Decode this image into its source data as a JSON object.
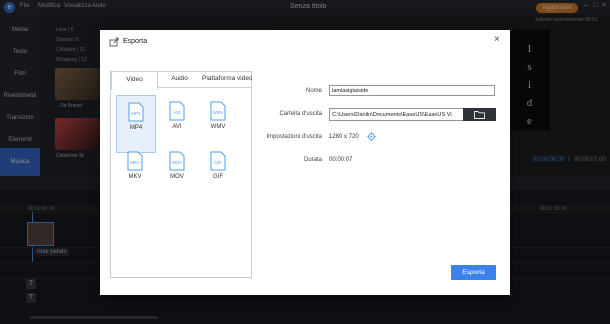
{
  "app": {
    "menu": [
      "File",
      "Modifica",
      "Visualizza",
      "Aiuto"
    ],
    "title": "Senza titolo",
    "upgrade_label": "Aggiornare",
    "saved_text": "Salvato recentemente 08:51",
    "timecode_current": "00:00:00.00",
    "timecode_sep": "/",
    "timecode_total": "00:00:07.00"
  },
  "sidebar": {
    "items": [
      {
        "label": "Media"
      },
      {
        "label": "Testo"
      },
      {
        "label": "Filtri"
      },
      {
        "label": "Rivestimenti"
      },
      {
        "label": "Transizion"
      },
      {
        "label": "Elementi"
      },
      {
        "label": "Musica"
      }
    ]
  },
  "media": {
    "list": [
      "Lista | 6",
      "Sfondo | 8",
      "Cellulare | 31",
      "Shopping | 13"
    ],
    "thumbs": [
      {
        "label": "Da Bravel"
      },
      {
        "label": "Celebrate Sr"
      }
    ]
  },
  "preview": {
    "letters": [
      "I",
      "s",
      "i",
      "d",
      "e"
    ]
  },
  "timeline": {
    "ruler_start": "00:00:00.00",
    "ruler_end": "00:01:38.00",
    "clip_name": "rose petals",
    "text_marker": "T"
  },
  "dialog": {
    "title": "Esporta",
    "close": "×",
    "tabs": [
      "Video",
      "Audio",
      "Piattaforma video"
    ],
    "formats": [
      {
        "ext": "MP4",
        "label": "MP4",
        "selected": true
      },
      {
        "ext": "AVI",
        "label": "AVI",
        "selected": false
      },
      {
        "ext": "WMV",
        "label": "WMV",
        "selected": false
      },
      {
        "ext": "MKV",
        "label": "MKV",
        "selected": false
      },
      {
        "ext": "MOV",
        "label": "MOV",
        "selected": false
      },
      {
        "ext": "GIF",
        "label": "GIF",
        "selected": false
      }
    ],
    "name_label": "Nome",
    "name_value": "lamiasiglaiside",
    "folder_label": "Cartella d'uscita",
    "folder_value": "C:\\Users\\Danilo\\Documents\\EaseUS\\EaseUS Vi",
    "settings_label": "Impostazioni d'uscita",
    "settings_value": "1280 x 720",
    "duration_label": "Durata",
    "duration_value": "00:00:07",
    "export_label": "Esporta"
  },
  "colors": {
    "accent": "#3b83ea",
    "upgrade": "#e88a2a",
    "sidebar_active": "#3a6fd8",
    "format_icon": "#4f9fe8"
  }
}
